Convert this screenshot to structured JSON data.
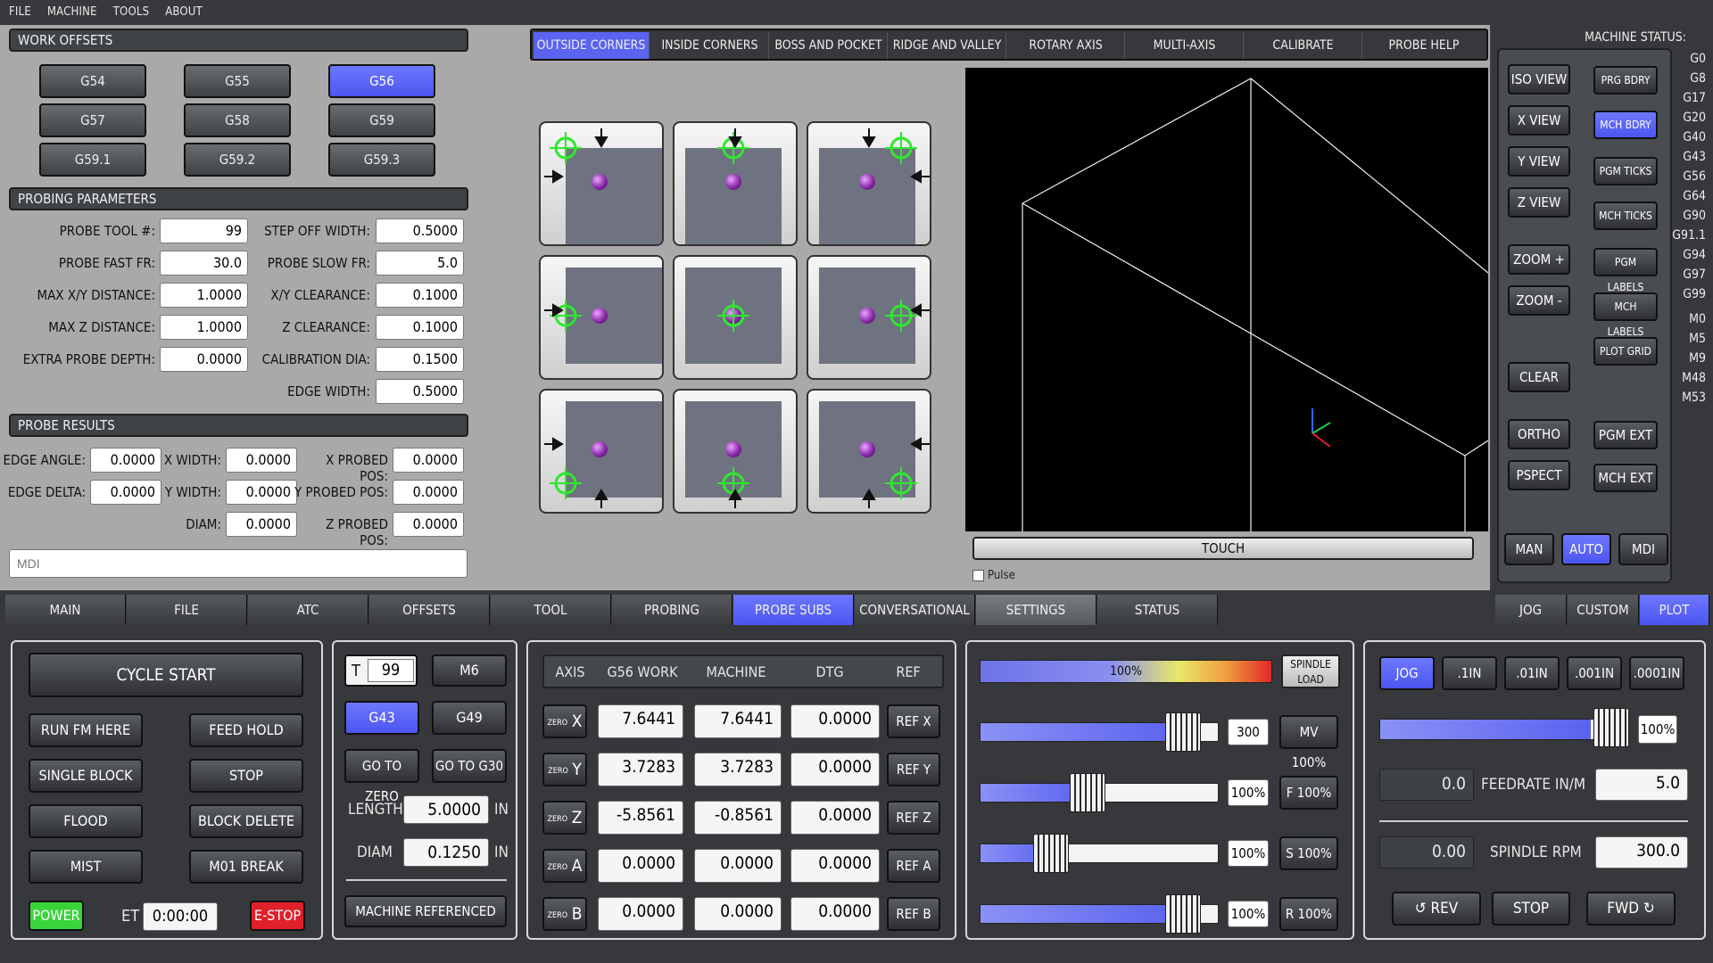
{
  "menu": [
    "FILE",
    "MACHINE",
    "TOOLS",
    "ABOUT"
  ],
  "work_offsets": {
    "title": "WORK OFFSETS",
    "buttons": [
      "G54",
      "G55",
      "G56",
      "G57",
      "G58",
      "G59",
      "G59.1",
      "G59.2",
      "G59.3"
    ],
    "selected": "G56"
  },
  "probing_parameters": {
    "title": "PROBING PARAMETERS",
    "left": [
      {
        "label": "PROBE TOOL #:",
        "value": "99"
      },
      {
        "label": "PROBE FAST FR:",
        "value": "30.0"
      },
      {
        "label": "MAX X/Y DISTANCE:",
        "value": "1.0000"
      },
      {
        "label": "MAX Z DISTANCE:",
        "value": "1.0000"
      },
      {
        "label": "EXTRA PROBE DEPTH:",
        "value": "0.0000"
      }
    ],
    "right": [
      {
        "label": "STEP OFF WIDTH:",
        "value": "0.5000"
      },
      {
        "label": "PROBE SLOW FR:",
        "value": "5.0"
      },
      {
        "label": "X/Y CLEARANCE:",
        "value": "0.1000"
      },
      {
        "label": "Z CLEARANCE:",
        "value": "0.1000"
      },
      {
        "label": "CALIBRATION DIA:",
        "value": "0.1500"
      },
      {
        "label": "EDGE WIDTH:",
        "value": "0.5000"
      }
    ]
  },
  "probe_results": {
    "title": "PROBE RESULTS",
    "edge_angle": {
      "label": "EDGE ANGLE:",
      "value": "0.0000"
    },
    "edge_delta": {
      "label": "EDGE DELTA:",
      "value": "0.0000"
    },
    "x_width": {
      "label": "X WIDTH:",
      "value": "0.0000"
    },
    "y_width": {
      "label": "Y WIDTH:",
      "value": "0.0000"
    },
    "diam": {
      "label": "DIAM:",
      "value": "0.0000"
    },
    "x_probed": {
      "label": "X PROBED POS:",
      "value": "0.0000"
    },
    "y_probed": {
      "label": "Y PROBED POS:",
      "value": "0.0000"
    },
    "z_probed": {
      "label": "Z PROBED POS:",
      "value": "0.0000"
    }
  },
  "mdi_placeholder": "MDI",
  "probe_tabs": [
    "OUTSIDE CORNERS",
    "INSIDE CORNERS",
    "BOSS AND POCKET",
    "RIDGE AND VALLEY",
    "ROTARY AXIS",
    "MULTI-AXIS",
    "CALIBRATE",
    "PROBE HELP"
  ],
  "probe_tab_selected": "OUTSIDE CORNERS",
  "touch_label": "TOUCH",
  "pulse_label": "Pulse",
  "machine_status": {
    "label": "MACHINE STATUS:",
    "codes": [
      "G0",
      "G8",
      "G17",
      "G20",
      "G40",
      "G43",
      "G56",
      "G64",
      "G90",
      "G91.1",
      "G94",
      "G97",
      "G99",
      "M0",
      "M5",
      "M9",
      "M48",
      "M53"
    ]
  },
  "view_buttons": {
    "left": [
      "ISO VIEW",
      "X VIEW",
      "Y VIEW",
      "Z VIEW",
      "ZOOM +",
      "ZOOM -",
      "CLEAR",
      "ORTHO",
      "PSPECT"
    ],
    "right": [
      "PRG BDRY",
      "MCH BDRY",
      "PGM TICKS",
      "MCH TICKS",
      "PGM LABELS",
      "MCH LABELS",
      "PLOT GRID",
      "PGM EXT",
      "MCH EXT"
    ],
    "right_selected": "MCH BDRY",
    "modes": [
      "MAN",
      "AUTO",
      "MDI"
    ],
    "mode_selected": "AUTO"
  },
  "main_tabs": [
    "MAIN",
    "FILE",
    "ATC",
    "OFFSETS",
    "TOOL",
    "PROBING",
    "PROBE SUBS",
    "CONVERSATIONAL",
    "SETTINGS",
    "STATUS"
  ],
  "main_tab_selected": "PROBE SUBS",
  "right_tabs": [
    "JOG",
    "CUSTOM",
    "PLOT"
  ],
  "right_tab_selected": "PLOT",
  "cycle": {
    "cycle_start": "CYCLE START",
    "buttons": [
      "RUN FM HERE",
      "FEED HOLD",
      "SINGLE BLOCK",
      "STOP",
      "FLOOD",
      "BLOCK DELETE",
      "MIST",
      "M01 BREAK"
    ],
    "power": "POWER",
    "et_label": "ET",
    "et_value": "0:00:00",
    "estop": "E-STOP"
  },
  "tool": {
    "t_label": "T",
    "t_value": "99",
    "m6": "M6",
    "g43": "G43",
    "g49": "G49",
    "go_zero": "GO TO ZERO",
    "go_g30": "GO TO G30",
    "length_label": "LENGTH",
    "length_value": "5.0000",
    "diam_label": "DIAM",
    "diam_value": "0.1250",
    "unit": "IN",
    "referenced": "MACHINE REFERENCED"
  },
  "dro": {
    "headers": [
      "AXIS",
      "G56 WORK",
      "MACHINE",
      "DTG",
      "REF"
    ],
    "zero_label": "ZERO",
    "rows": [
      {
        "axis": "X",
        "work": "7.6441",
        "machine": "7.6441",
        "dtg": "0.0000",
        "ref": "REF X"
      },
      {
        "axis": "Y",
        "work": "3.7283",
        "machine": "3.7283",
        "dtg": "0.0000",
        "ref": "REF Y"
      },
      {
        "axis": "Z",
        "work": "-5.8561",
        "machine": "-0.8561",
        "dtg": "0.0000",
        "ref": "REF Z"
      },
      {
        "axis": "A",
        "work": "0.0000",
        "machine": "0.0000",
        "dtg": "0.0000",
        "ref": "REF A"
      },
      {
        "axis": "B",
        "work": "0.0000",
        "machine": "0.0000",
        "dtg": "0.0000",
        "ref": "REF B"
      }
    ]
  },
  "overrides": {
    "spindle_load_pct": "100%",
    "spindle_load": "SPINDLE LOAD",
    "rows": [
      {
        "value": "300",
        "button": "MV 100%",
        "fill": 0.85
      },
      {
        "value": "100%",
        "button": "F 100%",
        "fill": 0.45
      },
      {
        "value": "100%",
        "button": "S 100%",
        "fill": 0.3
      },
      {
        "value": "100%",
        "button": "R 100%",
        "fill": 0.85
      }
    ]
  },
  "jog": {
    "increments": [
      "JOG",
      ".1IN",
      ".01IN",
      ".001IN",
      ".0001IN"
    ],
    "selected": "JOG",
    "jog_pct": "100%",
    "feed_actual": "0.0",
    "feed_label": "FEEDRATE IN/M",
    "feed_set": "5.0",
    "rpm_actual": "0.00",
    "rpm_label": "SPINDLE RPM",
    "rpm_set": "300.0",
    "rev": "REV",
    "stop": "STOP",
    "fwd": "FWD"
  },
  "colors": {
    "accent": "#5a64f0",
    "power": "#38d43a",
    "estop": "#e0202a",
    "probe_marker": "#2ee82e"
  }
}
